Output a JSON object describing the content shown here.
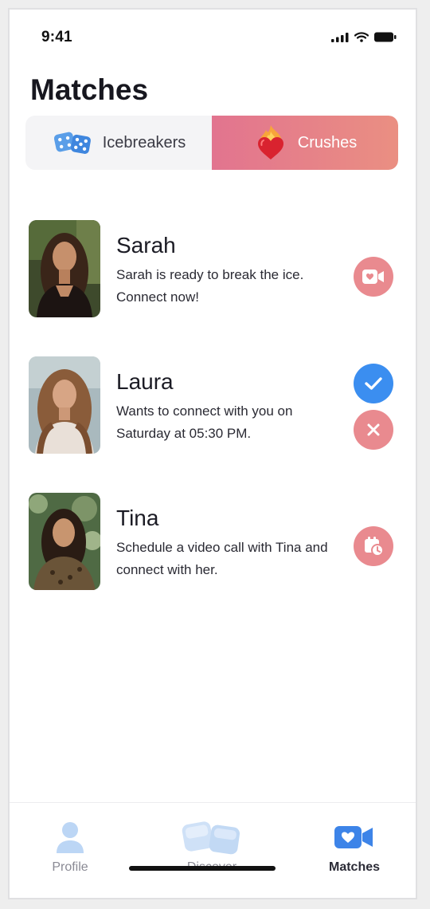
{
  "status": {
    "time": "9:41"
  },
  "header": {
    "title": "Matches"
  },
  "segments": {
    "left_label": "Icebreakers",
    "right_label": "Crushes"
  },
  "matches": [
    {
      "name": "Sarah",
      "text": "Sarah is ready to break the ice. Connect now!",
      "action_icon": "video-call-icon"
    },
    {
      "name": "Laura",
      "text": "Wants to connect with you on Saturday at 05:30 PM.",
      "action_icons": [
        "check-icon",
        "close-icon"
      ]
    },
    {
      "name": "Tina",
      "text": "Schedule a video call with Tina and connect with her.",
      "action_icon": "schedule-call-icon"
    }
  ],
  "tabbar": {
    "items": [
      {
        "label": "Profile",
        "icon": "person-icon"
      },
      {
        "label": "Discover",
        "icon": "dice-icon"
      },
      {
        "label": "Matches",
        "icon": "video-heart-icon",
        "active": true
      }
    ]
  },
  "colors": {
    "accent_gradient_start": "#e2748f",
    "accent_gradient_end": "#ea8f82",
    "action_pink": "#e98a8f",
    "action_blue": "#3b8ef0",
    "tab_active_blue": "#3d84e8"
  }
}
